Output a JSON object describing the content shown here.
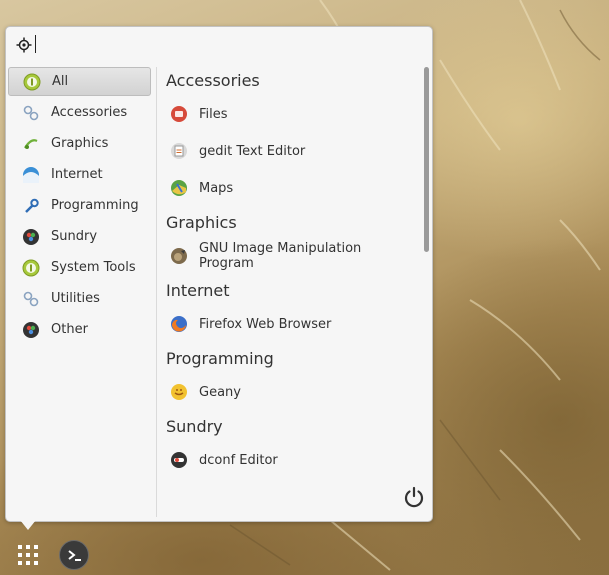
{
  "search": {
    "placeholder": "",
    "value": ""
  },
  "categories": [
    {
      "label": "All",
      "icon": "all-icon",
      "active": true
    },
    {
      "label": "Accessories",
      "icon": "accessories-icon"
    },
    {
      "label": "Graphics",
      "icon": "graphics-icon"
    },
    {
      "label": "Internet",
      "icon": "internet-icon"
    },
    {
      "label": "Programming",
      "icon": "programming-icon"
    },
    {
      "label": "Sundry",
      "icon": "sundry-icon"
    },
    {
      "label": "System Tools",
      "icon": "system-tools-icon"
    },
    {
      "label": "Utilities",
      "icon": "utilities-icon"
    },
    {
      "label": "Other",
      "icon": "other-icon"
    }
  ],
  "sections": [
    {
      "title": "Accessories",
      "apps": [
        {
          "label": "Files",
          "icon": "files-icon"
        },
        {
          "label": "gedit Text Editor",
          "icon": "gedit-icon"
        },
        {
          "label": "Maps",
          "icon": "maps-icon"
        }
      ]
    },
    {
      "title": "Graphics",
      "apps": [
        {
          "label": "GNU Image Manipulation Program",
          "icon": "gimp-icon"
        }
      ]
    },
    {
      "title": "Internet",
      "apps": [
        {
          "label": "Firefox Web Browser",
          "icon": "firefox-icon"
        }
      ]
    },
    {
      "title": "Programming",
      "apps": [
        {
          "label": "Geany",
          "icon": "geany-icon"
        }
      ]
    },
    {
      "title": "Sundry",
      "apps": [
        {
          "label": "dconf Editor",
          "icon": "dconf-icon"
        }
      ]
    }
  ],
  "footer": {
    "power_icon": "power-icon"
  },
  "taskbar": {
    "launcher_icon": "app-grid-icon",
    "terminal_icon": "terminal-icon"
  },
  "colors": {
    "accent_green": "#a7c93b",
    "menu_bg": "#f6f6f6"
  }
}
